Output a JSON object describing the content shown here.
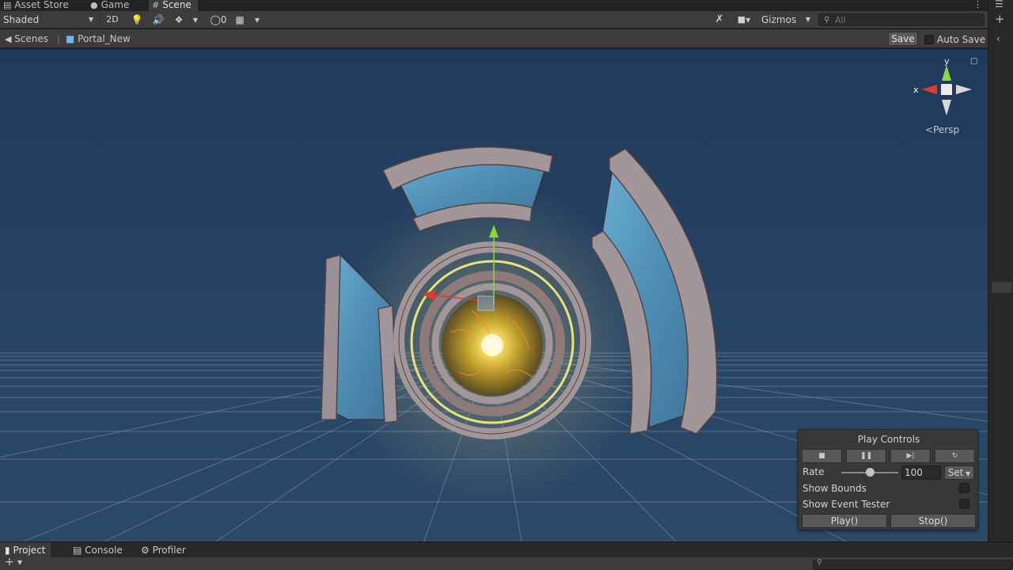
{
  "tabs": [
    {
      "label": "Asset Store",
      "icon": "shopping-bag-icon"
    },
    {
      "label": "Game",
      "icon": "gamepad-icon"
    },
    {
      "label": "Scene",
      "icon": "grid-icon",
      "active": true
    }
  ],
  "toolbar": {
    "draw_mode": "Shaded",
    "mode_2d": "2D",
    "hidden_count": "0",
    "gizmos_label": "Gizmos",
    "search_placeholder": "All"
  },
  "breadcrumb": {
    "root": "Scenes",
    "prefab": "Portal_New",
    "save_label": "Save",
    "auto_save_label": "Auto Save",
    "auto_save_checked": false
  },
  "gizmo": {
    "y_label": "y",
    "x_label": "x",
    "projection_label": "Persp"
  },
  "play_controls": {
    "title": "Play Controls",
    "buttons": [
      "stop-icon",
      "pause-icon",
      "step-icon",
      "restart-icon"
    ],
    "rate_label": "Rate",
    "rate_value": "100",
    "rate_fraction": 0.5,
    "set_label": "Set",
    "show_bounds_label": "Show Bounds",
    "show_bounds_checked": false,
    "show_event_tester_label": "Show Event Tester",
    "show_event_tester_checked": false,
    "play_label": "Play()",
    "stop_label": "Stop()"
  },
  "bottom_tabs": [
    {
      "label": "Project",
      "icon": "folder-icon",
      "active": true
    },
    {
      "label": "Console",
      "icon": "console-icon"
    },
    {
      "label": "Profiler",
      "icon": "profiler-icon"
    }
  ],
  "colors": {
    "viewport_bg": "#24405e",
    "panel_bg": "#3c3c3c",
    "axis_x": "#e03a2a",
    "axis_y": "#8ad83a",
    "glow": "#ffe066",
    "stone": "#a99c9f",
    "panel_blue": "#5b9cc0"
  }
}
